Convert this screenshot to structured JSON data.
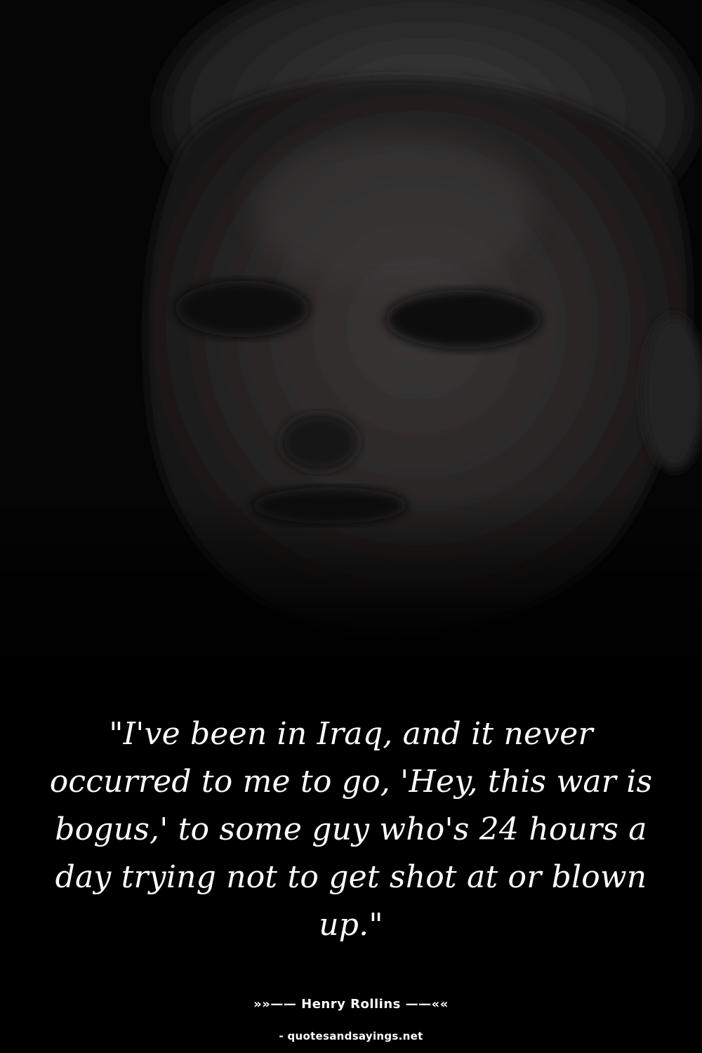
{
  "quote": {
    "text": "\"I've been in Iraq, and it never occurred to me to go, 'Hey, this war is bogus,' to some guy who's 24 hours a day trying not to get shot at or blown up.\""
  },
  "author": {
    "line": "»»—— Henry Rollins ——««"
  },
  "source": {
    "line": "- quotesandsayings.net"
  },
  "colors": {
    "background": "#000000",
    "text": "#ffffff"
  }
}
